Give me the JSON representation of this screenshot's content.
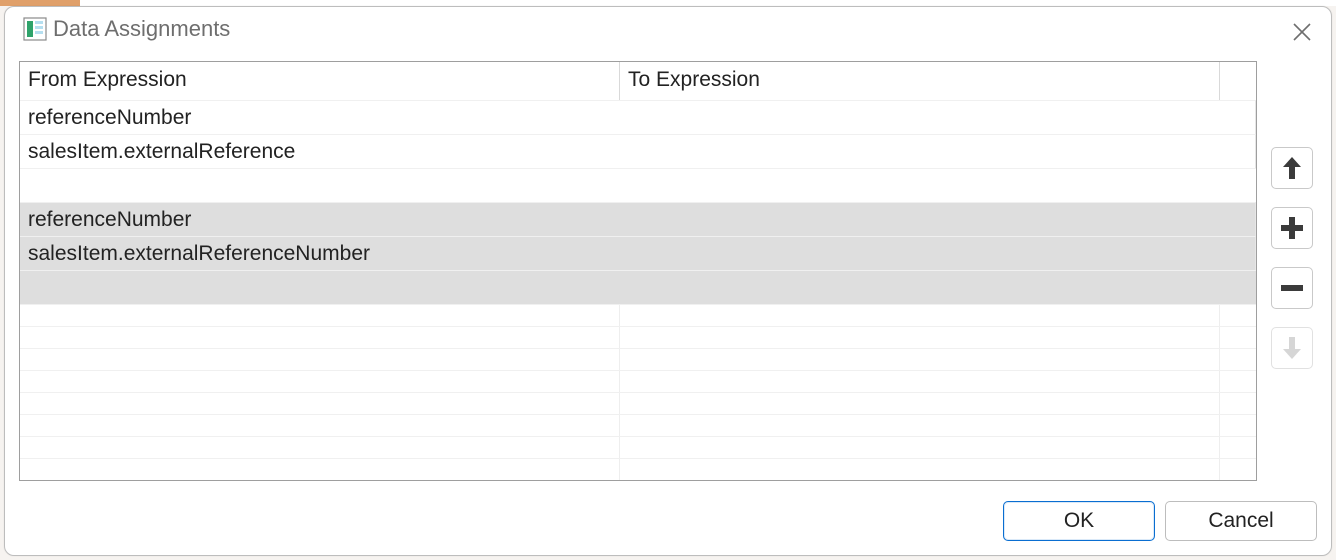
{
  "dialog": {
    "title": "Data Assignments"
  },
  "table": {
    "columns": {
      "from": "From Expression",
      "to": "To Expression"
    },
    "rows": [
      {
        "from": "referenceNumber",
        "to": "salesItem.externalReference",
        "selected": false
      },
      {
        "from": "referenceNumber",
        "to": "salesItem.externalReferenceNumber",
        "selected": true
      }
    ]
  },
  "side": {
    "moveUp": "Move Up",
    "add": "Add",
    "remove": "Remove",
    "moveDown": "Move Down",
    "moveDownDisabled": true
  },
  "footer": {
    "ok": "OK",
    "cancel": "Cancel"
  }
}
